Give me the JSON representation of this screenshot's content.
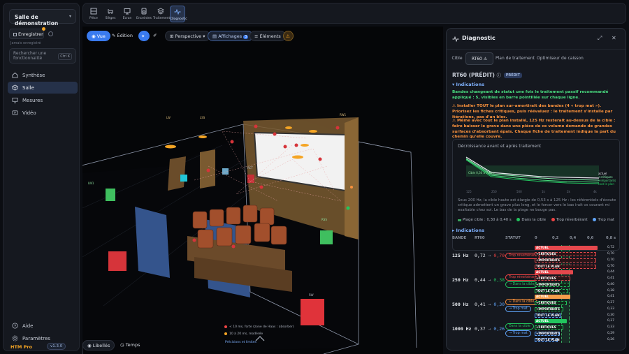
{
  "sidebar": {
    "room_select": "Salle de démonstration",
    "save_label": "Enregistrer",
    "save_sub": "Jamais enregistré",
    "search_placeholder": "Rechercher une fonctionnalité",
    "search_kbd": "Ctrl K",
    "nav": [
      {
        "label": "Synthèse",
        "icon": "home-icon",
        "active": false
      },
      {
        "label": "Salle",
        "icon": "cube-icon",
        "active": true
      },
      {
        "label": "Mesures",
        "icon": "monitor-icon",
        "active": false
      },
      {
        "label": "Vidéo",
        "icon": "video-icon",
        "active": false
      }
    ],
    "bottom_nav": [
      {
        "label": "Aide",
        "icon": "help-icon"
      },
      {
        "label": "Paramètres",
        "icon": "gear-icon"
      }
    ],
    "brand": "HTM Pro",
    "version": "v1.3.0"
  },
  "toolbar": {
    "tools": [
      {
        "label": "Pièce",
        "icon": "room-icon"
      },
      {
        "label": "Sièges",
        "icon": "seat-icon"
      },
      {
        "label": "Écran",
        "icon": "screen-icon"
      },
      {
        "label": "Enceintes",
        "icon": "speaker-icon"
      },
      {
        "label": "Traitement",
        "icon": "layers-icon"
      },
      {
        "label": "Diagnostic",
        "icon": "pulse-icon",
        "active": true
      }
    ]
  },
  "viewport": {
    "view_label": "Vue",
    "edit_label": "Édition",
    "perspective_label": "Perspective",
    "display_label": "Affichages",
    "display_count": "3",
    "elements_label": "Éléments",
    "labels_label": "Libellés",
    "time_label": "Temps",
    "legend_1": "< 10 ms, forte (zone de Haas : absorber)",
    "legend_2": "10 à 20 ms, modérée",
    "legend_3": "Précisions et limites",
    "tags": [
      "LW1",
      "LW",
      "LSS",
      "RW1",
      "RSS",
      "RCT",
      "RW"
    ]
  },
  "panel": {
    "title": "Diagnostic",
    "tabs": [
      {
        "label": "Cible",
        "active": false
      },
      {
        "label": "RT60 ⚠",
        "active": true
      },
      {
        "label": "Plan de traitement",
        "active": false
      },
      {
        "label": "Optimiseur de caisson",
        "active": false
      }
    ],
    "section_title": "RT60 (PRÉDIT)",
    "section_pill": "PRÉDIT",
    "indications_label": "Indications",
    "msg_green": "Bandes changeant de statut une fois le traitement passif recommandé appliqué : 5, visibles en barre pointillée sur chaque ligne.",
    "msg_orange_1": "⚠ Installer TOUT le plan sur-amortirait des bandes (4 « trop mat »). Priorisez les fiches critiques, puis réévaluez : le traitement s'installe par itérations, pas d'un bloc.",
    "msg_orange_2": "⚠ Même avec tout le plan installé, 125 Hz resterait au-dessus de la cible : faire baisser le grave dans une pièce de ce volume demande de grandes surfaces d'absorbant épais. Chaque fiche de traitement indique la part du chemin qu'elle couvre.",
    "chart": {
      "title": "Décroissance avant et après traitement",
      "target_label": "Cible 0,30 à 0,40 s",
      "caption": "Sous 200 Hz, la cible haute est élargie de 0,53 s à 125 Hz : les référentiels d'écoute critique admettent un grave plus long, et le forcer vers le bas irait vs courant mi exaltable chez soi. Le bas de la plage ne bouge pas.",
      "end_labels": [
        "actuel",
        "+critiques",
        "+importants",
        "tout le plan"
      ],
      "x_ticks": [
        "125",
        "250",
        "500",
        "1k",
        "2k",
        "4k"
      ]
    },
    "chart_legend": [
      {
        "label": "Plage cible : 0,30 à 0,40 s",
        "color": "#3aa55d"
      },
      {
        "label": "Dans la cible",
        "color": "#22c55e"
      },
      {
        "label": "Trop réverbérant",
        "color": "#ef4444"
      },
      {
        "label": "Trop mat",
        "color": "#60a5fa"
      }
    ],
    "indications2_label": "Indications",
    "table_headers": [
      "BANDE",
      "RT60",
      "STATUT"
    ],
    "table_scale": [
      "0",
      "0,2",
      "0,4",
      "0,6",
      "0,8 s"
    ],
    "bands": [
      {
        "band": "125 Hz",
        "rt_now": "0,72",
        "rt_after": "0,70",
        "after_color": "#ef4444",
        "chips": [
          {
            "label": "Trop réverbérant",
            "color": "#ef4444"
          }
        ],
        "bars": [
          {
            "label": "ACTUEL",
            "value": 0.72,
            "text": "0,72",
            "color": "#e5484d"
          },
          {
            "label": "+CRITIQUES",
            "value": 0.7,
            "text": "0,70",
            "color": "#2a1518",
            "outline": "#e5484d"
          },
          {
            "label": "+IMPORTANTS",
            "value": 0.7,
            "text": "0,70",
            "color": "#2a1518",
            "outline": "#e5484d"
          },
          {
            "label": "TOUT LE PLAN",
            "value": 0.7,
            "text": "0,70",
            "color": "#2a1518",
            "outline": "#e5484d"
          }
        ]
      },
      {
        "band": "250 Hz",
        "rt_now": "0,44",
        "rt_after": "0,38",
        "after_color": "#22c55e",
        "chips": [
          {
            "label": "Trop réverbérant",
            "color": "#ef4444"
          },
          {
            "label": "→ Dans la cible",
            "color": "#22c55e"
          }
        ],
        "bars": [
          {
            "label": "ACTUEL",
            "value": 0.44,
            "text": "0,44",
            "color": "#e5484d"
          },
          {
            "label": "+CRITIQUES",
            "value": 0.41,
            "text": "0,41",
            "color": "#2a1518",
            "outline": "#e5484d"
          },
          {
            "label": "+IMPORTANTS",
            "value": 0.4,
            "text": "0,40",
            "color": "#12261a",
            "outline": "#22c55e"
          },
          {
            "label": "TOUT LE PLAN",
            "value": 0.38,
            "text": "0,38",
            "color": "#12261a",
            "outline": "#22c55e"
          }
        ]
      },
      {
        "band": "500 Hz",
        "rt_now": "0,41",
        "rt_after": "0,30",
        "after_color": "#60a5fa",
        "chips": [
          {
            "label": "≈ Dans la cible",
            "color": "#fb923c"
          },
          {
            "label": "→ Trop mat",
            "color": "#60a5fa"
          }
        ],
        "bars": [
          {
            "label": "ACTUEL",
            "value": 0.41,
            "text": "0,41",
            "color": "#f59e4b"
          },
          {
            "label": "+CRITIQUES",
            "value": 0.37,
            "text": "0,37",
            "color": "#12261a",
            "outline": "#22c55e"
          },
          {
            "label": "+IMPORTANTS",
            "value": 0.33,
            "text": "0,33",
            "color": "#12261a",
            "outline": "#22c55e"
          },
          {
            "label": "TOUT LE PLAN",
            "value": 0.3,
            "text": "0,30",
            "color": "#13203a",
            "outline": "#60a5fa"
          }
        ]
      },
      {
        "band": "1000 Hz",
        "rt_now": "0,37",
        "rt_after": "0,26",
        "after_color": "#60a5fa",
        "chips": [
          {
            "label": "Dans la cible",
            "color": "#22c55e"
          },
          {
            "label": "→ Trop mat",
            "color": "#60a5fa"
          }
        ],
        "bars": [
          {
            "label": "ACTUEL",
            "value": 0.37,
            "text": "0,37",
            "color": "#22c55e"
          },
          {
            "label": "+CRITIQUES",
            "value": 0.33,
            "text": "0,33",
            "color": "#12261a",
            "outline": "#22c55e"
          },
          {
            "label": "+IMPORTANTS",
            "value": 0.29,
            "text": "0,29",
            "color": "#13203a",
            "outline": "#60a5fa"
          },
          {
            "label": "TOUT LE PLAN",
            "value": 0.26,
            "text": "0,26",
            "color": "#13203a",
            "outline": "#60a5fa"
          }
        ]
      }
    ]
  }
}
